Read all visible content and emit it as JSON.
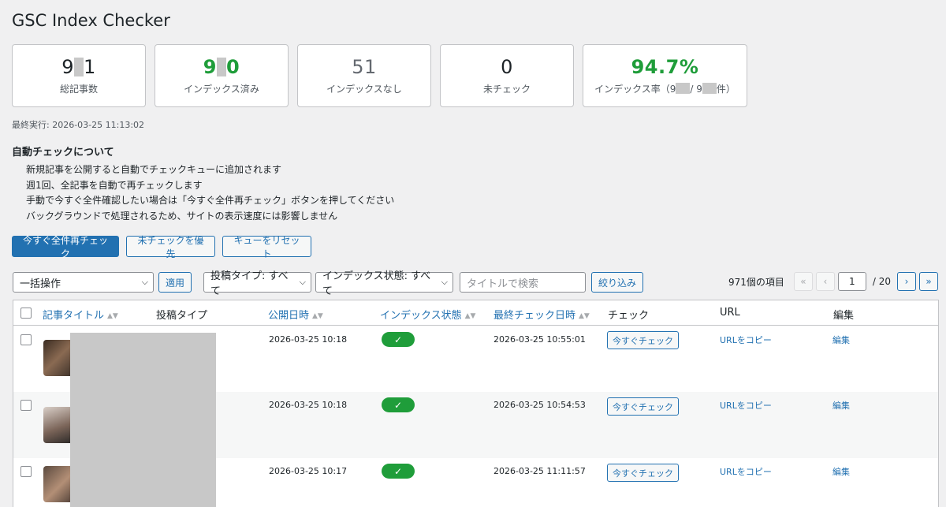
{
  "page_title": "GSC Index Checker",
  "stats": [
    {
      "num_a": "9",
      "num_b": "1",
      "label": "総記事数"
    },
    {
      "num_a": "9",
      "num_b": "0",
      "label": "インデックス済み"
    },
    {
      "num": "51",
      "label": "インデックスなし"
    },
    {
      "num": "0",
      "label": "未チェック"
    },
    {
      "num": "94.7%",
      "label_a": "インデックス率（9",
      "label_b": "/ 9",
      "label_c": "件）"
    }
  ],
  "last_run": "最終実行: 2026-03-25 11:13:02",
  "about": {
    "title": "自動チェックについて",
    "items": [
      "新規記事を公開すると自動でチェックキューに追加されます",
      "週1回、全記事を自動で再チェックします",
      "手動で今すぐ全件確認したい場合は「今すぐ全件再チェック」ボタンを押してください",
      "バックグラウンドで処理されるため、サイトの表示速度には影響しません"
    ]
  },
  "actions": {
    "recheck_all": "今すぐ全件再チェック",
    "prioritize_unchecked": "未チェックを優先",
    "reset_queue": "キューをリセット"
  },
  "filters": {
    "bulk_action": "一括操作",
    "apply": "適用",
    "post_type": "投稿タイプ: すべて",
    "index_status": "インデックス状態: すべて",
    "search_placeholder": "タイトルで検索",
    "filter_btn": "絞り込み"
  },
  "pagination": {
    "item_count": "971個の項目",
    "first": "«",
    "prev": "‹",
    "current": "1",
    "total": "/ 20",
    "next": "›",
    "last": "»"
  },
  "table": {
    "headers": {
      "title": "記事タイトル",
      "post_type": "投稿タイプ",
      "published": "公開日時",
      "index_status": "インデックス状態",
      "last_check": "最終チェック日時",
      "check": "チェック",
      "url": "URL",
      "edit": "編集"
    },
    "rows": [
      {
        "published": "2026-03-25 10:18",
        "status": "✓",
        "last_check": "2026-03-25 10:55:01",
        "check_btn": "今すぐチェック",
        "url_link": "URLをコピー",
        "edit_link": "編集"
      },
      {
        "published": "2026-03-25 10:18",
        "status": "✓",
        "last_check": "2026-03-25 10:54:53",
        "check_btn": "今すぐチェック",
        "url_link": "URLをコピー",
        "edit_link": "編集"
      },
      {
        "published": "2026-03-25 10:17",
        "status": "✓",
        "last_check": "2026-03-25 11:11:57",
        "check_btn": "今すぐチェック",
        "url_link": "URLをコピー",
        "edit_link": "編集"
      }
    ]
  },
  "colors": {
    "accent": "#2271b1",
    "success": "#1f9d3a",
    "muted": "#646970"
  }
}
